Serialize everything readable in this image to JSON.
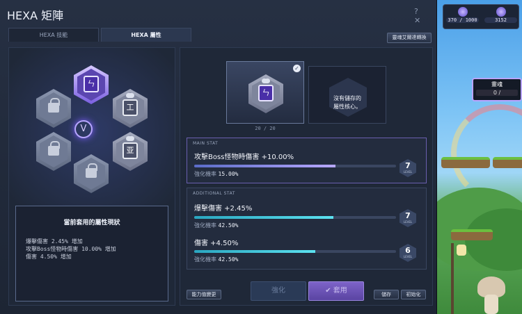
{
  "window": {
    "title": "HEXA 矩陣",
    "help_label": "?",
    "close_label": "✕"
  },
  "tabs": [
    {
      "label": "HEXA 技能"
    },
    {
      "label": "HEXA 屬性"
    }
  ],
  "convert_button": "靈魂艾爾達轉換",
  "hud": {
    "resource_1": "370 / 1000",
    "resource_2": "3152",
    "quest_title": "靈魂",
    "quest_progress": "0 /"
  },
  "core_slots": {
    "count": "20 / 20",
    "empty_text_line1": "沒有儲存的",
    "empty_text_line2": "屬性核心。"
  },
  "status": {
    "title": "當前套用的屬性現狀",
    "lines": [
      "爆擊傷害 2.45% 增加",
      "攻擊Boss怪物時傷害 10.00% 增加",
      "傷害 4.50% 增加"
    ]
  },
  "main_stat": {
    "header": "MAIN STAT",
    "name": "攻擊Boss怪物時傷害 +10.00%",
    "rate_label": "強化機率",
    "rate": "15.00%",
    "level": "7",
    "level_label": "LEVEL",
    "progress": 0.7
  },
  "additional_stat": {
    "header": "ADDITIONAL STAT",
    "items": [
      {
        "name": "爆擊傷害 +2.45%",
        "rate_label": "強化機率",
        "rate": "42.50%",
        "level": "7",
        "level_label": "LEVEL",
        "progress": 0.69
      },
      {
        "name": "傷害 +4.50%",
        "rate_label": "強化機率",
        "rate": "42.50%",
        "level": "6",
        "level_label": "LEVEL",
        "progress": 0.6
      }
    ]
  },
  "buttons": {
    "ability_change": "能力值變更",
    "strengthen": "強化",
    "apply": "套用",
    "save": "儲存",
    "reset": "初始化"
  },
  "colors": {
    "accent_purple": "#7a5fe0",
    "bar_cyan": "#5ce2f0",
    "window_bg": "#263043"
  },
  "icons": [
    "gem-icon",
    "lock-icon",
    "rune-icon",
    "check-icon",
    "v-emblem-icon"
  ]
}
